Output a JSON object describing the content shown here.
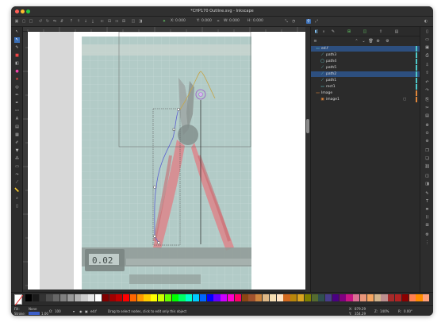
{
  "window": {
    "title": "*CHP170 Outline.svg - Inkscape",
    "traffic_lights": [
      "#ff5f57",
      "#febc2e",
      "#28c840"
    ]
  },
  "toolbar": {
    "x_value": "0.000",
    "y_value": "0.000",
    "w_value": "0.000",
    "h_value": "0.000"
  },
  "layers": {
    "items": [
      {
        "label": "ed.f",
        "icon": "layer-icon",
        "depth": 0,
        "selected": true,
        "stripe": "#4ec9c9"
      },
      {
        "label": "path3",
        "icon": "path-icon",
        "depth": 1,
        "selected": false,
        "stripe": "#4ec9c9"
      },
      {
        "label": "path4",
        "icon": "path-icon",
        "depth": 1,
        "selected": false,
        "stripe": "#4ec9c9"
      },
      {
        "label": "path5",
        "icon": "path-icon",
        "depth": 1,
        "selected": false,
        "stripe": "#4ec9c9"
      },
      {
        "label": "path2",
        "icon": "path-icon",
        "depth": 1,
        "selected": true,
        "stripe": "#4ec9c9"
      },
      {
        "label": "path1",
        "icon": "path-icon",
        "depth": 1,
        "selected": false,
        "stripe": "#4ec9c9"
      },
      {
        "label": "rect1",
        "icon": "rect-icon",
        "depth": 1,
        "selected": false,
        "stripe": "#4ec9c9"
      },
      {
        "label": "Image",
        "icon": "layer-icon",
        "depth": 0,
        "selected": false,
        "stripe": "#e0863a"
      },
      {
        "label": "image1",
        "icon": "image-icon",
        "depth": 1,
        "selected": false,
        "stripe": "#e0863a"
      }
    ]
  },
  "palette": {
    "colors": [
      "#000000",
      "#1a1a1a",
      "#333333",
      "#4d4d4d",
      "#666666",
      "#808080",
      "#999999",
      "#b3b3b3",
      "#cccccc",
      "#e6e6e6",
      "#ffffff",
      "#800000",
      "#a00000",
      "#c00000",
      "#ff0000",
      "#ff6600",
      "#ff9900",
      "#ffcc00",
      "#ffff00",
      "#ccff00",
      "#66ff00",
      "#00ff00",
      "#00ff66",
      "#00ffcc",
      "#00ccff",
      "#0066ff",
      "#0000ff",
      "#6600ff",
      "#cc00ff",
      "#ff00cc",
      "#ff0066",
      "#8b4513",
      "#a0522d",
      "#cd853f",
      "#deb887",
      "#f5deb3",
      "#ffe4c4",
      "#d2691e",
      "#b8860b",
      "#daa520",
      "#808000",
      "#556b2f",
      "#2f4f4f",
      "#483d8b",
      "#4b0082",
      "#800080",
      "#c71585",
      "#db7093",
      "#e9967a",
      "#f4a460",
      "#d2b48c",
      "#bc8f8f",
      "#a52a2a",
      "#b22222",
      "#8b0000",
      "#ff7f50",
      "#ff8c00",
      "#ffa07a"
    ]
  },
  "status": {
    "fill_label": "Fill:",
    "stroke_label": "Stroke:",
    "fill_value": "None",
    "stroke_width": "1.00",
    "opacity": "100",
    "layer_name": "ed.f",
    "message": "Drag to select nodes, click to edit only this object",
    "x_label": "X:",
    "y_label": "Y:",
    "x_coord": "879.29",
    "y_coord": "354.29",
    "z_label": "Z:",
    "zoom": "140%",
    "rotation_label": "R:",
    "rotation": "0.00°"
  }
}
